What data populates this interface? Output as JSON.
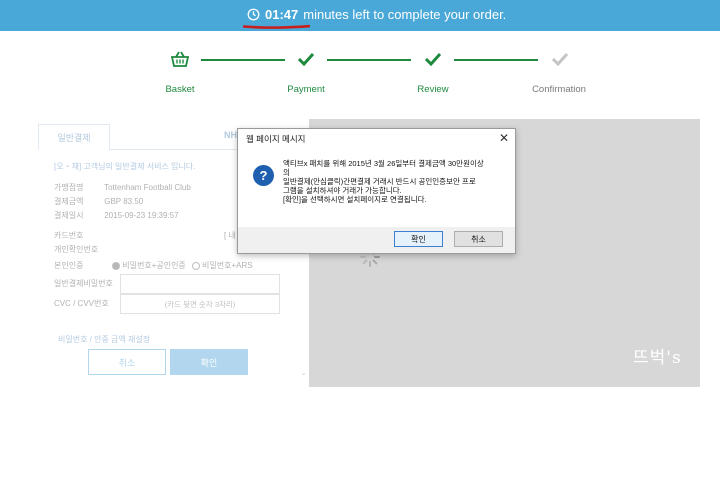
{
  "topbar": {
    "time": "01:47",
    "message": "minutes left to complete your order.",
    "bg_color": "#4aa8d8",
    "underline_color": "#c81e1e"
  },
  "steps": [
    {
      "label": "Basket",
      "icon": "basket-icon",
      "state": "done"
    },
    {
      "label": "Payment",
      "icon": "check-icon",
      "state": "done"
    },
    {
      "label": "Review",
      "icon": "check-icon",
      "state": "done"
    },
    {
      "label": "Confirmation",
      "icon": "check-icon",
      "state": "pending"
    }
  ],
  "payform": {
    "tab_general": "일반결제",
    "tab_other": "NH",
    "intro": "[오・채] 고객님의 일반결제 서비스 입니다.",
    "merchant_key": "가맹점명",
    "merchant_val": "Tottenham Football Club",
    "amount_key": "결제금액",
    "amount_val": "GBP 83.50",
    "date_key": "결제일시",
    "date_val": "2015-09-23 19:39:57",
    "card_key": "카드번호",
    "card_edge": "[ 내",
    "personal_key": "개인확인번호",
    "auth_key": "본인인증",
    "auth_opt1": "비밀번호+공인인증",
    "auth_opt2": "비밀번호+ARS",
    "pw_key": "일반결제비밀번호",
    "cvc_key": "CVC / CVV번호",
    "cvc_placeholder": "(카드 뒷면 숫자 3자리)",
    "reset_link": "비밀번호 / 안중 금액 재설정",
    "cancel_label": "취소",
    "ok_label": "확인"
  },
  "watermark": "뜨벅's",
  "dialog": {
    "title": "웹 페이지 메시지",
    "close": "✕",
    "message_lines": [
      "액티브x 패치를 위해 2015년 3월 26일부터 결제금액 30만원이상",
      "의",
      "일반결제(안심클릭)간편결제 거래시 반드시 공인인증보안 프로",
      "그램을 설치하셔야 거래가 가능합니다.",
      "[확인]을 선택하시면 설치페이지로 연결됩니다."
    ],
    "ok_label": "확인",
    "cancel_label": "취소"
  }
}
